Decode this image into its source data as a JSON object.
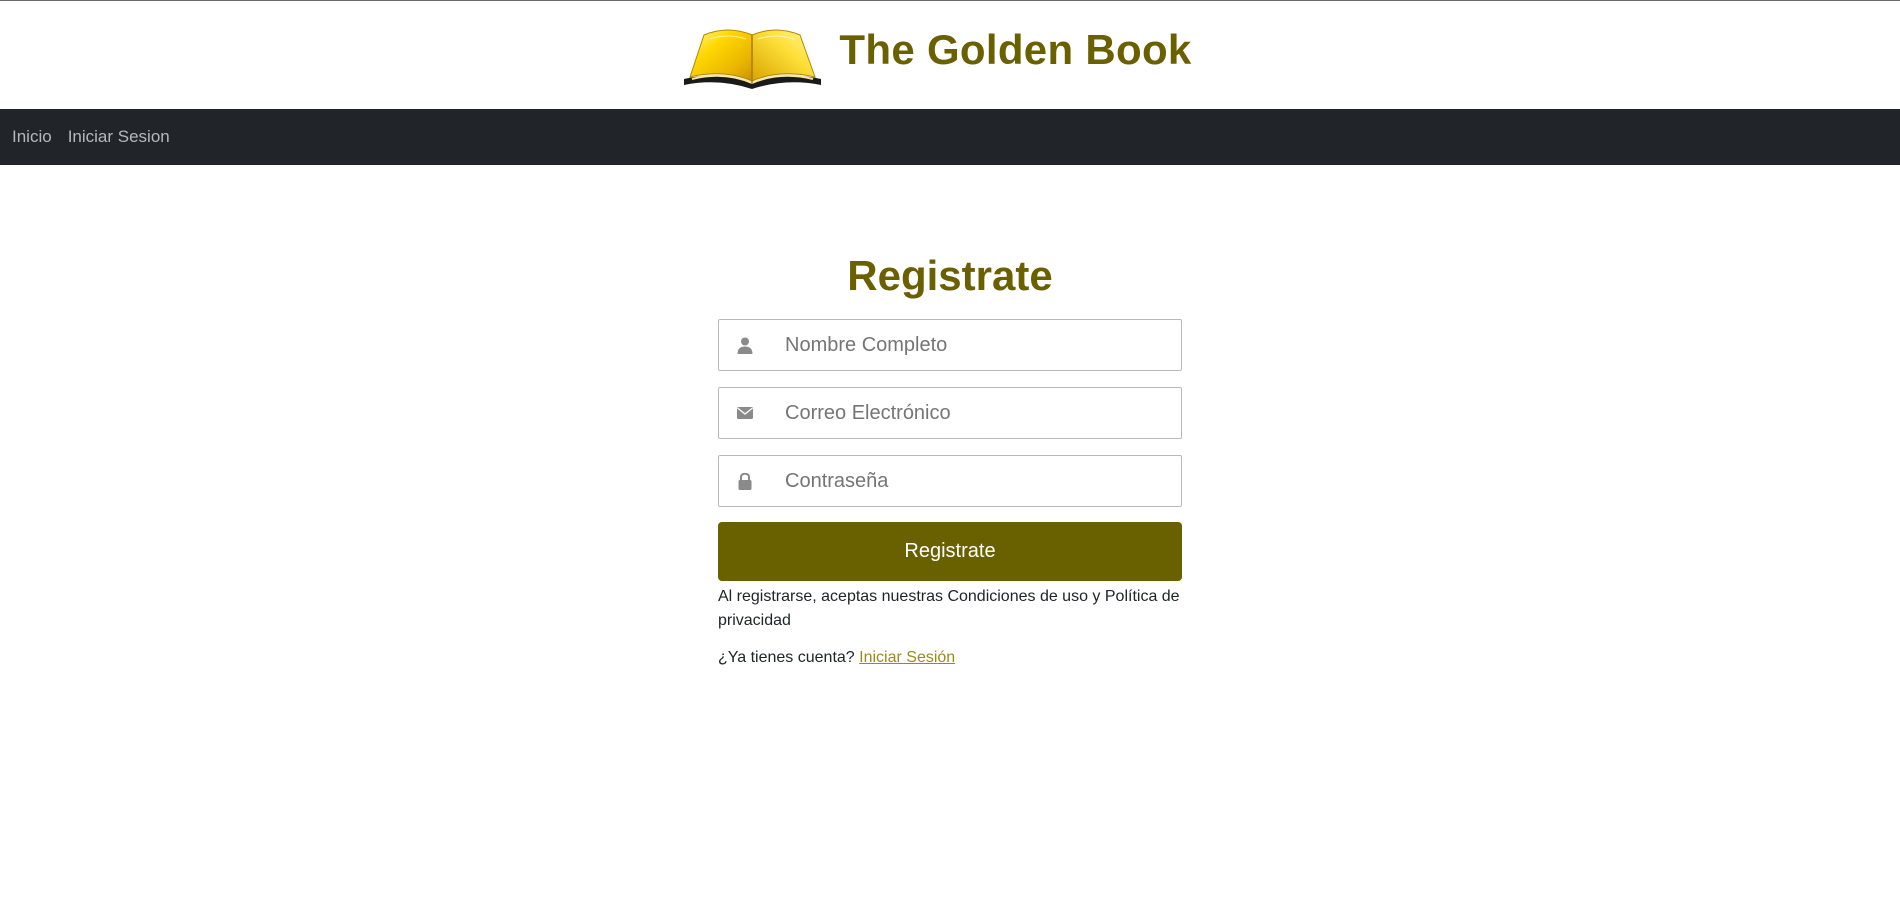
{
  "header": {
    "title": "The Golden Book",
    "logo_icon": "golden-open-book-icon"
  },
  "navbar": {
    "items": [
      {
        "label": "Inicio"
      },
      {
        "label": "Iniciar Sesion"
      }
    ]
  },
  "form": {
    "title": "Registrate",
    "fields": [
      {
        "placeholder": "Nombre Completo",
        "value": "",
        "icon": "user-icon"
      },
      {
        "placeholder": "Correo Electrónico",
        "value": "",
        "icon": "envelope-icon"
      },
      {
        "placeholder": "Contraseña",
        "value": "",
        "icon": "lock-icon"
      }
    ],
    "submit_label": "Registrate",
    "terms_text": "Al registrarse, aceptas nuestras Condiciones de uso y Política de privacidad",
    "login_prompt": "¿Ya tienes cuenta?",
    "login_link": "Iniciar Sesión"
  },
  "colors": {
    "brand": "#6a6000",
    "navbar_bg": "#212529",
    "button_bg": "#696000",
    "link": "#9a8a1a"
  }
}
